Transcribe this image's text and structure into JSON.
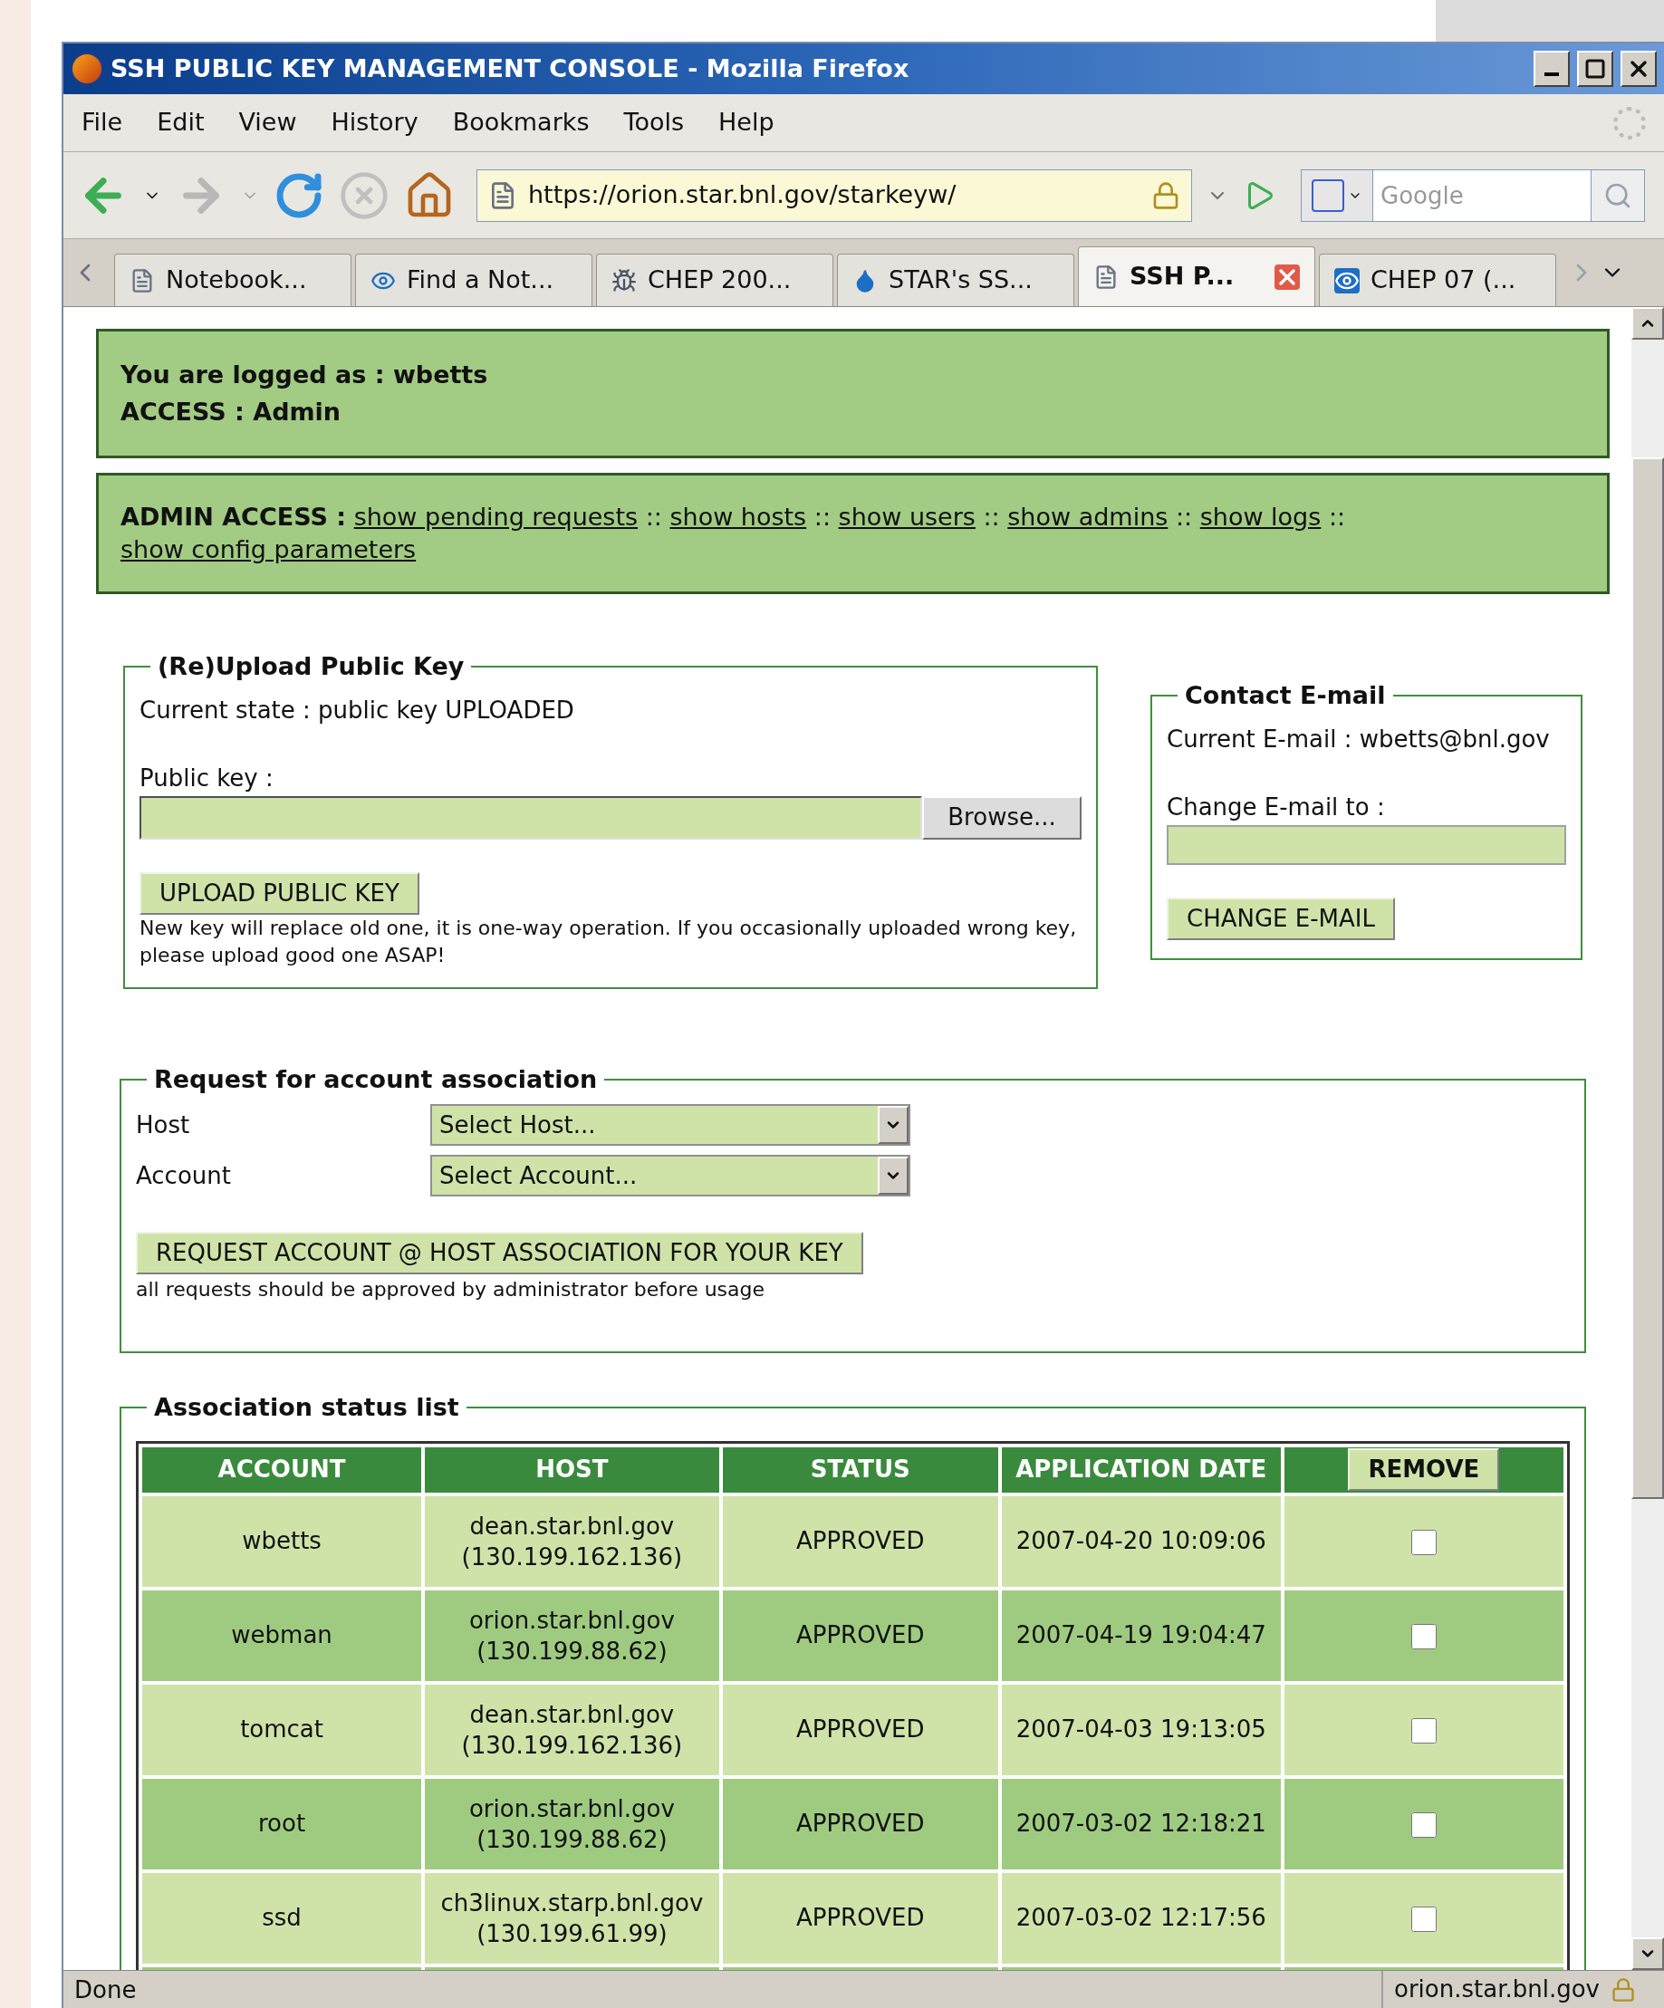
{
  "window": {
    "title": "SSH PUBLIC KEY MANAGEMENT CONSOLE - Mozilla Firefox"
  },
  "menu": [
    "File",
    "Edit",
    "View",
    "History",
    "Bookmarks",
    "Tools",
    "Help"
  ],
  "address_bar": {
    "value": "https://orion.star.bnl.gov/starkeyw/"
  },
  "search": {
    "placeholder": "Google"
  },
  "tabs": [
    {
      "label": "Notebook...",
      "selected": false
    },
    {
      "label": "Find a Not...",
      "selected": false
    },
    {
      "label": "CHEP 200...",
      "selected": false
    },
    {
      "label": "STAR's SS...",
      "selected": false
    },
    {
      "label": "SSH P...",
      "selected": true
    },
    {
      "label": "CHEP 07 (...",
      "selected": false
    }
  ],
  "login_panel": {
    "user_line": "You are logged as : wbetts",
    "access_line": "ACCESS : Admin"
  },
  "admin_panel": {
    "label": "ADMIN ACCESS :",
    "separator": "::",
    "links": [
      "show pending requests",
      "show hosts",
      "show users",
      "show admins",
      "show logs",
      "show config parameters"
    ]
  },
  "upload": {
    "legend": "(Re)Upload Public Key",
    "state": "Current state : public key UPLOADED",
    "field_label": "Public key :",
    "browse": "Browse...",
    "button": "UPLOAD PUBLIC KEY",
    "note": "New key will replace old one, it is one-way operation. If you occasionally uploaded wrong key, please upload good one ASAP!"
  },
  "email": {
    "legend": "Contact E-mail",
    "current": "Current E-mail : wbetts@bnl.gov",
    "field_label": "Change E-mail to :",
    "button": "CHANGE E-MAIL"
  },
  "request": {
    "legend": "Request for account association",
    "host_label": "Host",
    "host_value": "Select Host...",
    "account_label": "Account",
    "account_value": "Select Account...",
    "button": "REQUEST ACCOUNT @ HOST ASSOCIATION FOR YOUR KEY",
    "note": "all requests should be approved by administrator before usage"
  },
  "status_list": {
    "legend": "Association status list",
    "columns": [
      "ACCOUNT",
      "HOST",
      "STATUS",
      "APPLICATION DATE"
    ],
    "remove_button": "REMOVE",
    "rows": [
      {
        "account": "wbetts",
        "host": "dean.star.bnl.gov",
        "address": "(130.199.162.136)",
        "status": "APPROVED",
        "date": "2007-04-20 10:09:06",
        "checked": false
      },
      {
        "account": "webman",
        "host": "orion.star.bnl.gov",
        "address": "(130.199.88.62)",
        "status": "APPROVED",
        "date": "2007-04-19 19:04:47",
        "checked": false
      },
      {
        "account": "tomcat",
        "host": "dean.star.bnl.gov",
        "address": "(130.199.162.136)",
        "status": "APPROVED",
        "date": "2007-04-03 19:13:05",
        "checked": false
      },
      {
        "account": "root",
        "host": "orion.star.bnl.gov",
        "address": "(130.199.88.62)",
        "status": "APPROVED",
        "date": "2007-03-02 12:18:21",
        "checked": false
      },
      {
        "account": "ssd",
        "host": "ch3linux.starp.bnl.gov",
        "address": "(130.199.61.99)",
        "status": "APPROVED",
        "date": "2007-03-02 12:17:56",
        "checked": false
      }
    ]
  },
  "status_bar": {
    "message": "Done",
    "host": "orion.star.bnl.gov"
  }
}
